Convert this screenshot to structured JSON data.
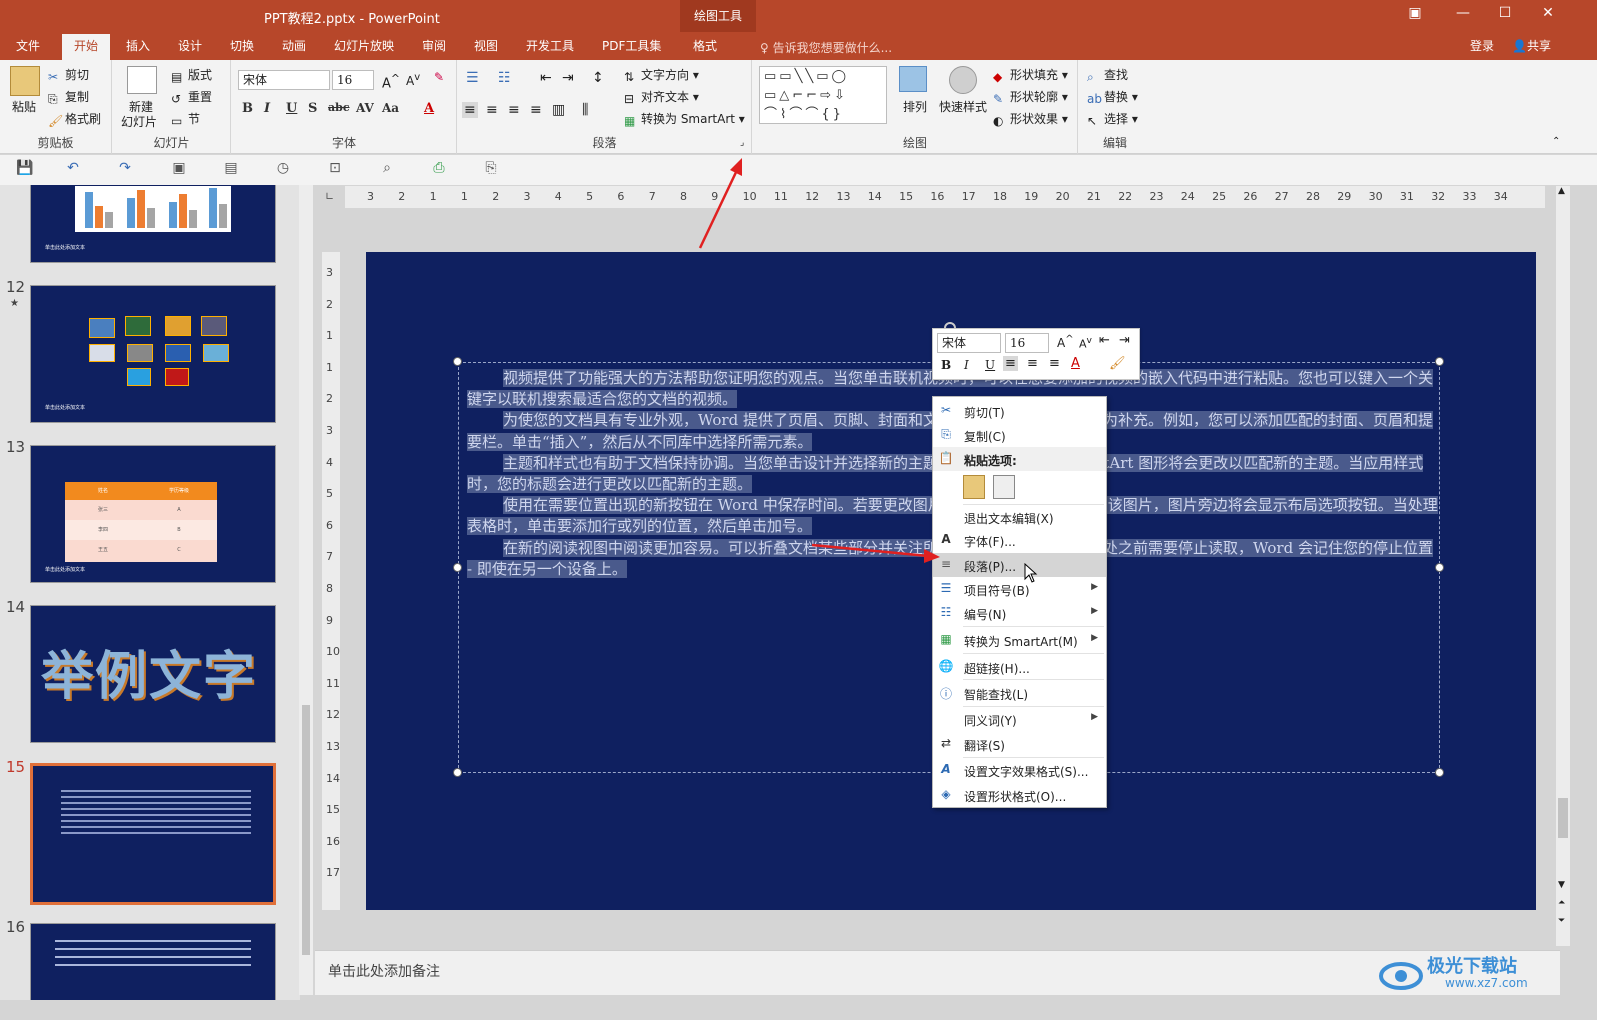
{
  "window": {
    "title": "PPT教程2.pptx - PowerPoint",
    "context_tab": "绘图工具"
  },
  "tabs": [
    "文件",
    "开始",
    "插入",
    "设计",
    "切换",
    "动画",
    "幻灯片放映",
    "审阅",
    "视图",
    "开发工具",
    "PDF工具集",
    "格式"
  ],
  "tell_me": "告诉我您想要做什么...",
  "account": {
    "login": "登录",
    "share": "共享"
  },
  "ribbon": {
    "clipboard": {
      "paste": "粘贴",
      "cut": "剪切",
      "copy": "复制",
      "format_painter": "格式刷",
      "label": "剪贴板"
    },
    "slides": {
      "new_slide_1": "新建",
      "new_slide_2": "幻灯片",
      "layout": "版式",
      "reset": "重置",
      "section": "节",
      "label": "幻灯片"
    },
    "font": {
      "name": "宋体",
      "size": "16",
      "label": "字体"
    },
    "paragraph": {
      "text_direction": "文字方向",
      "align_text": "对齐文本",
      "convert_smartart": "转换为 SmartArt",
      "label": "段落"
    },
    "drawing": {
      "arrange": "排列",
      "quick_styles": "快速样式",
      "shape_fill": "形状填充",
      "shape_outline": "形状轮廓",
      "shape_effects": "形状效果",
      "label": "绘图"
    },
    "editing": {
      "find": "查找",
      "replace": "替换",
      "select": "选择",
      "label": "编辑"
    }
  },
  "ruler_h": [
    "3",
    "2",
    "1",
    "1",
    "2",
    "3",
    "4",
    "5",
    "6",
    "7",
    "8",
    "9",
    "10",
    "11",
    "12",
    "13",
    "14",
    "15",
    "16",
    "17",
    "18",
    "19",
    "20",
    "21",
    "22",
    "23",
    "24",
    "25",
    "26",
    "27",
    "28",
    "29",
    "30",
    "31",
    "32",
    "33",
    "34"
  ],
  "ruler_v": [
    "3",
    "2",
    "1",
    "1",
    "2",
    "3",
    "4",
    "5",
    "6",
    "7",
    "8",
    "9",
    "10",
    "11",
    "12",
    "13",
    "14",
    "15",
    "16",
    "17"
  ],
  "thumbnails": [
    {
      "num": "",
      "caption": "单击此处添加文本"
    },
    {
      "num": "12",
      "star": "★",
      "caption": "单击此处添加文本"
    },
    {
      "num": "13",
      "caption": "单击此处添加文本",
      "table_head": [
        "姓名",
        "学历等级"
      ],
      "table_rows": [
        [
          "张三",
          "A"
        ],
        [
          "李四",
          "B"
        ],
        [
          "王五",
          "C"
        ]
      ]
    },
    {
      "num": "14",
      "big_text": "举例文字"
    },
    {
      "num": "15"
    },
    {
      "num": "16"
    }
  ],
  "slide_text": [
    "视频提供了功能强大的方法帮助您证明您的观点。当您单击联机视频时，可以在想要添加的视频的嵌入代码中进行粘贴。您也可以键入一个关键字以联机搜索最适合您的文档的视频。",
    "为使您的文档具有专业外观，Word 提供了页眉、页脚、封面和文本框设计，这些设计可互为补充。例如，您可以添加匹配的封面、页眉和提要栏。单击“插入”，然后从不同库中选择所需元素。",
    "主题和样式也有助于文档保持协调。当您单击设计并选择新的主题时，图片、图表或 SmartArt 图形将会更改以匹配新的主题。当应用样式时，您的标题会进行更改以匹配新的主题。",
    "使用在需要位置出现的新按钮在 Word 中保存时间。若要更改图片适应文档的方式，请单击该图片，图片旁边将会显示布局选项按钮。当处理表格时，单击要添加行或列的位置，然后单击加号。",
    "在新的阅读视图中阅读更加容易。可以折叠文档某些部分并关注所需文本。如果在达到结尾处之前需要停止读取，Word 会记住您的停止位置 - 即使在另一个设备上。"
  ],
  "mini_toolbar": {
    "font": "宋体",
    "size": "16",
    "bold": "B",
    "italic": "I",
    "underline": "U"
  },
  "context_menu": [
    {
      "label": "剪切(T)",
      "icon": "scissors-icon"
    },
    {
      "label": "复制(C)",
      "icon": "copy-icon"
    },
    {
      "label": "粘贴选项:",
      "icon": "paste-icon",
      "header": true
    },
    {
      "label": "退出文本编辑(X)"
    },
    {
      "label": "字体(F)...",
      "icon": "font-icon"
    },
    {
      "label": "段落(P)...",
      "icon": "paragraph-icon",
      "highlighted": true
    },
    {
      "label": "项目符号(B)",
      "icon": "bullets-icon",
      "submenu": true
    },
    {
      "label": "编号(N)",
      "icon": "numbering-icon",
      "submenu": true
    },
    {
      "label": "转换为 SmartArt(M)",
      "icon": "smartart-icon",
      "submenu": true
    },
    {
      "label": "超链接(H)...",
      "icon": "hyperlink-icon"
    },
    {
      "label": "智能查找(L)",
      "icon": "smart-lookup-icon"
    },
    {
      "label": "同义词(Y)",
      "submenu": true
    },
    {
      "label": "翻译(S)",
      "icon": "translate-icon"
    },
    {
      "label": "设置文字效果格式(S)...",
      "icon": "text-effect-icon"
    },
    {
      "label": "设置形状格式(O)...",
      "icon": "shape-format-icon"
    }
  ],
  "notes_placeholder": "单击此处添加备注",
  "watermark": {
    "name": "极光下载站",
    "url": "www.xz7.com"
  },
  "colors": {
    "accent": "#b7472a",
    "slide_bg": "#0f2060",
    "selection": "#4a5a8c",
    "annotation": "#e02020"
  }
}
